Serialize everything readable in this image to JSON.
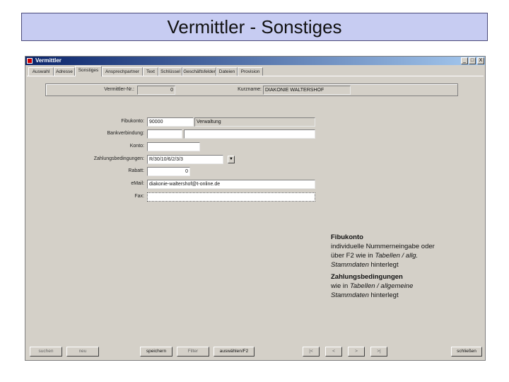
{
  "slide_title": "Vermittler - Sonstiges",
  "window": {
    "title": "Vermittler",
    "controls": [
      "_",
      "□",
      "X"
    ]
  },
  "tabs": [
    "Auswahl",
    "Adresse",
    "Sonstiges",
    "Ansprechpartner",
    "Text",
    "Schlüssel",
    "Geschäftsfelder",
    "Dateien",
    "Provision"
  ],
  "header": {
    "vermittler_nr_label": "Vermittler-Nr.:",
    "vermittler_nr_value": "0",
    "kurzname_label": "Kurzname:",
    "kurzname_value": "DIAKONIE WALTERSHOF"
  },
  "form": {
    "fibukonto_label": "Fibukonto:",
    "fibukonto_value": "90000",
    "fibukonto_desc": "Verwaltung",
    "bankverbindung_label": "Bankverbindung:",
    "konto_label": "Konto:",
    "zahlung_label": "Zahlungsbedingungen:",
    "zahlung_value": "R/30/10/6/2/3/3",
    "rabatt_label": "Rabatt:",
    "rabatt_value": "0",
    "email_label": "eMail:",
    "email_value": "diakonie-waltershof@t-online.de",
    "fax_label": "Fax:"
  },
  "info": {
    "fibukonto_title": "Fibukonto",
    "fibukonto_text1": "individuelle Nummerneingabe oder über F2 wie in ",
    "fibukonto_text2": "Tabellen / allg. Stammdaten",
    "fibukonto_text3": " hinterlegt",
    "zahlung_title": "Zahlungsbedingungen",
    "zahlung_text1": "wie in ",
    "zahlung_text2": "Tabellen / allgemeine Stammdaten",
    "zahlung_text3": " hinterlegt"
  },
  "buttons": {
    "suchen": "suchen",
    "neu": "neu",
    "speichern": "speichern",
    "filter": "Filter",
    "auswahl": "auswählen/F2",
    "first": "|<",
    "prev": "<",
    "next": ">",
    "last": ">|",
    "schliessen": "schließen"
  }
}
